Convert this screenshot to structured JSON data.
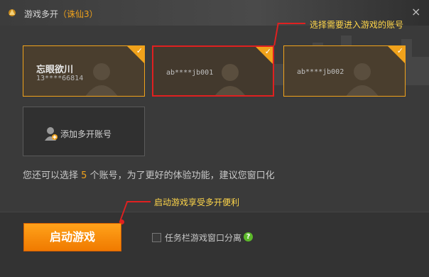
{
  "window": {
    "title": "游戏多开",
    "paren_open": "（",
    "server": "诛仙3",
    "paren_close": "）",
    "close_glyph": "×"
  },
  "callouts": {
    "select_accounts": "选择需要进入游戏的账号",
    "start_benefit": "启动游戏享受多开便利"
  },
  "accounts": [
    {
      "nickname": "忘眼欲川",
      "account": "13****66814",
      "checked": true
    },
    {
      "account": "ab****jb001",
      "checked": true
    },
    {
      "account": "ab****jb002",
      "checked": true
    }
  ],
  "add_account": {
    "label": "添加多开账号"
  },
  "hint": {
    "prefix": "您还可以选择",
    "count": "5",
    "suffix": "个账号，为了更好的体验功能，建议您窗口化"
  },
  "start_button": {
    "label": "启动游戏"
  },
  "taskbar_option": {
    "label": "任务栏游戏窗口分离",
    "checked": false,
    "help_glyph": "?"
  },
  "colors": {
    "accent": "#f0a21b",
    "callout": "#ffd64a",
    "highlight": "#e02020",
    "start": "#ff8c0a"
  },
  "icons": [
    "game-logo-icon",
    "close-icon",
    "check-icon",
    "add-user-icon",
    "help-icon"
  ]
}
